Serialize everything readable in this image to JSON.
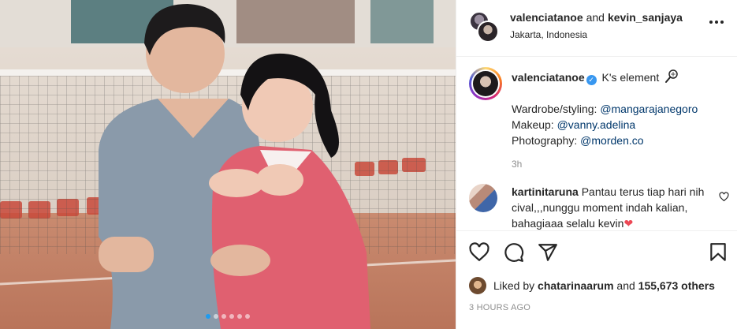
{
  "post": {
    "carousel": {
      "total_slides": 6,
      "active_slide": 1
    }
  },
  "header": {
    "user1": "valenciatanoe",
    "connector": "and",
    "user2": "kevin_sanjaya",
    "location": "Jakarta, Indonesia",
    "more_icon": "more-horizontal-icon"
  },
  "caption": {
    "username": "valenciatanoe",
    "verified_icon": "verified-badge-icon",
    "title": "K's element",
    "emoji_icon": "badminton-racket-icon",
    "lines": [
      {
        "label": "Wardrobe/styling: ",
        "mention": "@mangarajanegoro"
      },
      {
        "label": "Makeup: ",
        "mention": "@vanny.adelina"
      },
      {
        "label": "Photography: ",
        "mention": "@morden.co"
      }
    ],
    "time": "3h"
  },
  "comment": {
    "username": "kartinitaruna",
    "text": "Pantau terus tiap hari nih cival,,,nunggu moment indah kalian, bahagiaaa selalu kevin",
    "emoji": "❤",
    "like_icon": "heart-outline-icon"
  },
  "actions": {
    "icons": [
      "heart-icon",
      "comment-icon",
      "share-icon",
      "bookmark-icon"
    ]
  },
  "likes": {
    "prefix": "Liked by",
    "user": "chatarinaarum",
    "connector": "and",
    "count": "155,673 others"
  },
  "timestamp": "3 HOURS AGO",
  "colors": {
    "link": "#00376b",
    "verified": "#3897f0",
    "muted": "#8e8e8e",
    "carousel_active_dot": "#1e9bf0",
    "heart": "#ed4956"
  }
}
